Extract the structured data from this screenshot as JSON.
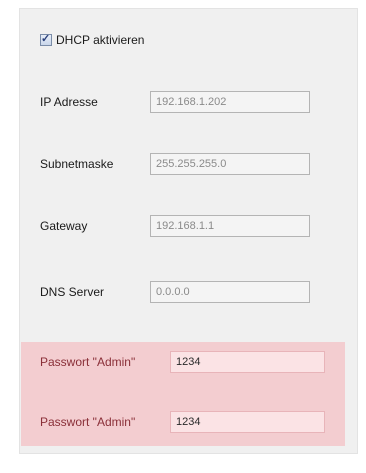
{
  "dhcp": {
    "label": "DHCP aktivieren",
    "checked": true
  },
  "fields": [
    {
      "label": "IP Adresse",
      "value": "192.168.1.202"
    },
    {
      "label": "Subnetmaske",
      "value": "255.255.255.0"
    },
    {
      "label": "Gateway",
      "value": "192.168.1.1"
    },
    {
      "label": "DNS Server",
      "value": "0.0.0.0"
    }
  ],
  "passwords": [
    {
      "label": "Passwort \"Admin\"",
      "value": "1234"
    },
    {
      "label": "Passwort \"Admin\"",
      "value": "1234"
    }
  ],
  "colors": {
    "highlight": "#f3cdd0",
    "password_label": "#8a2f38"
  }
}
